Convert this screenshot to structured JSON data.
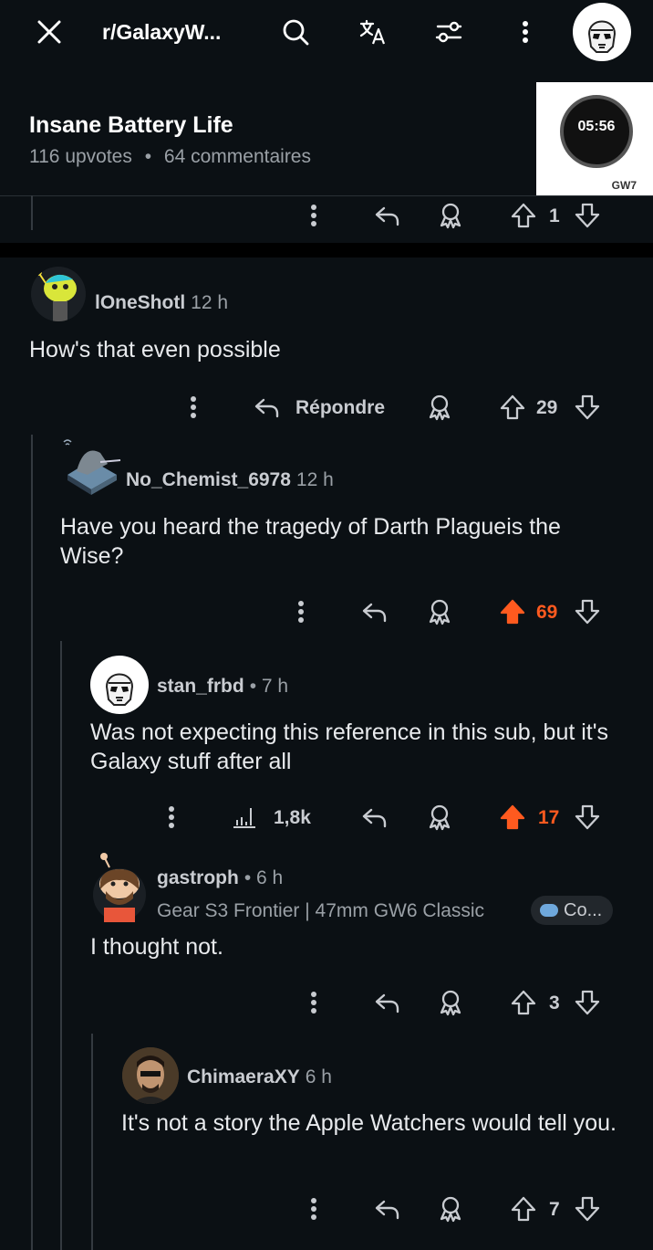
{
  "header": {
    "subreddit": "r/GalaxyW...",
    "post_title": "Insane Battery Life",
    "upvotes": "116 upvotes",
    "separator": "•",
    "comments": "64 commentaires",
    "thumbnail_time": "05:56",
    "thumbnail_caption": "GW7"
  },
  "top_actions": {
    "votes": "1"
  },
  "comments": [
    {
      "user": "lOneShotl",
      "time": "12 h",
      "body": "How's that even possible",
      "reply_label": "Répondre",
      "votes": "29",
      "upvoted": false
    },
    {
      "user": "No_Chemist_6978",
      "time": "12 h",
      "body": "Have you heard the tragedy of Darth Plagueis the Wise?",
      "votes": "69",
      "upvoted": true
    },
    {
      "user": "stan_frbd",
      "time": "• 7 h",
      "body": "Was not expecting this reference in this sub, but it's Galaxy stuff after all",
      "insights": "1,8k",
      "votes": "17",
      "upvoted": true
    },
    {
      "user": "gastroph",
      "time": "• 6 h",
      "flair_text": "Gear S3 Frontier | 47mm GW6 Classic",
      "flair_badge": "Co...",
      "body": "I thought not.",
      "votes": "3",
      "upvoted": false
    },
    {
      "user": "ChimaeraXY",
      "time": "6 h",
      "body": "It's not a story the Apple Watchers would tell you.",
      "votes": "7",
      "upvoted": false
    }
  ],
  "colors": {
    "background": "#0b1014",
    "upvote_active": "#ff5a1f",
    "muted_text": "#9aa0a6",
    "thread_line": "#343a40"
  }
}
